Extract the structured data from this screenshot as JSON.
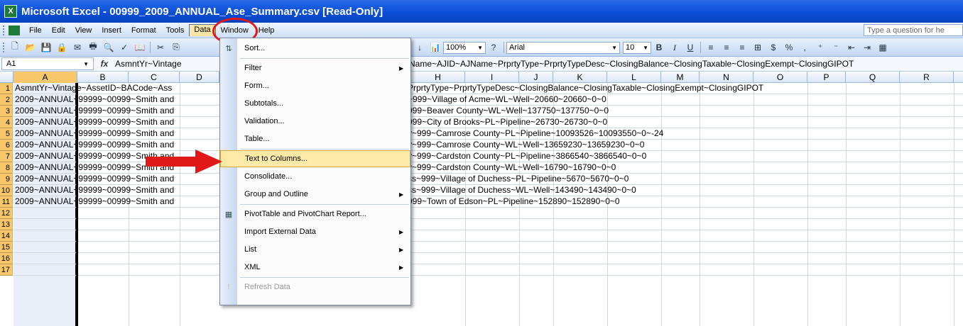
{
  "window": {
    "title": "Microsoft Excel - 00999_2009_ANNUAL_Ase_Summary.csv  [Read-Only]",
    "app_icon": "excel-icon"
  },
  "menubar": {
    "items": [
      "File",
      "Edit",
      "View",
      "Insert",
      "Format",
      "Tools",
      "Data",
      "Window",
      "Help"
    ],
    "open_menu": "Data",
    "ask_placeholder": "Type a question for he"
  },
  "toolbar": {
    "zoom": "100%",
    "font": "Arial",
    "font_size": "10",
    "bold": "B",
    "italic": "I",
    "underline": "U",
    "currency": "$",
    "percent": "%",
    "comma": ","
  },
  "formula_bar": {
    "name_box": "A1",
    "fx": "fx",
    "left_text": "AsmntYr~Vintage",
    "right_text": "Name~AJID~AJName~PrprtyType~PrprtyTypeDesc~ClosingBalance~ClosingTaxable~ClosingExempt~ClosingGIPOT"
  },
  "grid": {
    "columns": [
      "A",
      "B",
      "C",
      "D",
      "H",
      "I",
      "J",
      "K",
      "L",
      "M",
      "N",
      "O",
      "P",
      "Q",
      "R"
    ],
    "selected_column": "A",
    "rows": [
      "1",
      "2",
      "3",
      "4",
      "5",
      "6",
      "7",
      "8",
      "9",
      "10",
      "11",
      "12",
      "13",
      "14",
      "15",
      "16",
      "17"
    ],
    "cells_left": [
      "AsmntYr~Vintage~AssetID~BACode~Ass",
      "2009~ANNUAL~99999~00999~Smith and",
      "2009~ANNUAL~99999~00999~Smith and",
      "2009~ANNUAL~99999~00999~Smith and",
      "2009~ANNUAL~99999~00999~Smith and",
      "2009~ANNUAL~99999~00999~Smith and",
      "2009~ANNUAL~99999~00999~Smith and",
      "2009~ANNUAL~99999~00999~Smith and",
      "2009~ANNUAL~99999~00999~Smith and",
      "2009~ANNUAL~99999~00999~Smith and",
      "2009~ANNUAL~99999~00999~Smith and"
    ],
    "cells_right": [
      "PrprtyType~PrprtyTypeDesc~ClosingBalance~ClosingTaxable~ClosingExempt~ClosingGIPOT",
      "~999~Village of Acme~WL~Well~20660~20660~0~0",
      "999~Beaver County~WL~Well~137750~137750~0~0",
      "999~City of Brooks~PL~Pipeline~26730~26730~0~0",
      "y~999~Camrose County~PL~Pipeline~10093526~10093550~0~-24",
      "y~999~Camrose County~WL~Well~13659230~13659230~0~0",
      "y~999~Cardston County~PL~Pipeline~3866540~3866540~0~0",
      "y~999~Cardston County~WL~Well~16790~16790~0~0",
      "ss~999~Village of Duchess~PL~Pipeline~5670~5670~0~0",
      "ss~999~Village of Duchess~WL~Well~143490~143490~0~0",
      "999~Town of Edson~PL~Pipeline~152890~152890~0~0"
    ]
  },
  "data_menu": {
    "items": [
      {
        "label": "Sort...",
        "icon": "sort-icon",
        "submenu": false
      },
      {
        "label": "Filter",
        "icon": "",
        "submenu": true
      },
      {
        "label": "Form...",
        "icon": "",
        "submenu": false
      },
      {
        "label": "Subtotals...",
        "icon": "",
        "submenu": false
      },
      {
        "label": "Validation...",
        "icon": "",
        "submenu": false
      },
      {
        "label": "Table...",
        "icon": "",
        "submenu": false
      },
      {
        "label": "Text to Columns...",
        "icon": "",
        "submenu": false,
        "highlighted": true
      },
      {
        "label": "Consolidate...",
        "icon": "",
        "submenu": false
      },
      {
        "label": "Group and Outline",
        "icon": "",
        "submenu": true
      },
      {
        "label": "PivotTable and PivotChart Report...",
        "icon": "pivot-icon",
        "submenu": false
      },
      {
        "label": "Import External Data",
        "icon": "",
        "submenu": true
      },
      {
        "label": "List",
        "icon": "",
        "submenu": true
      },
      {
        "label": "XML",
        "icon": "",
        "submenu": true
      },
      {
        "label": "Refresh Data",
        "icon": "refresh-icon",
        "submenu": false,
        "disabled": true
      }
    ]
  },
  "annotations": {
    "circle_color": "#e01818",
    "arrow_color": "#e01818"
  }
}
